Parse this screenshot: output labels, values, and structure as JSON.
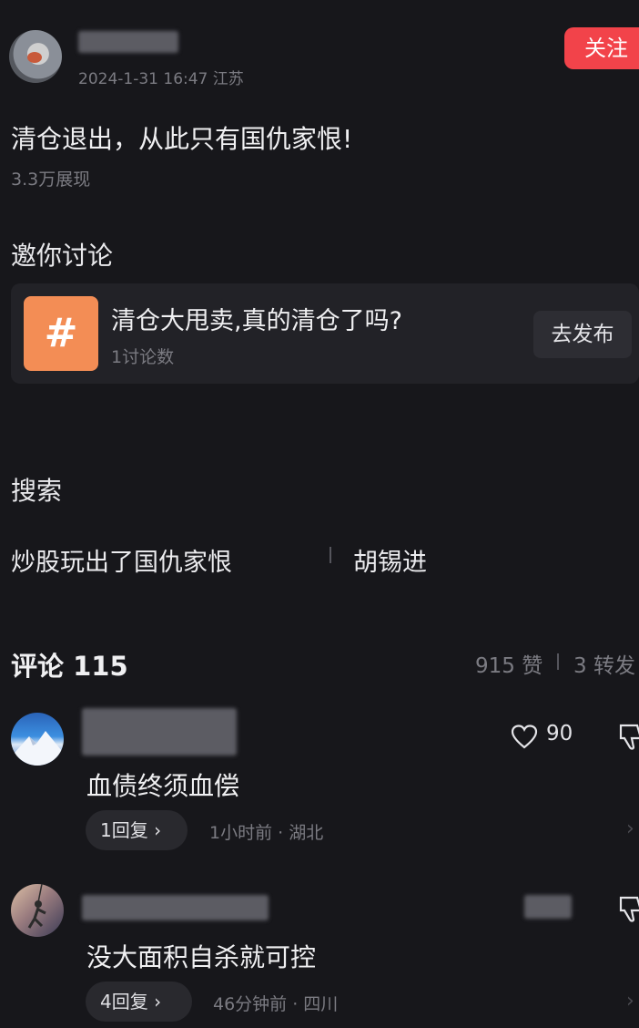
{
  "header": {
    "meta": "2024-1-31 16:47 江苏",
    "follow_label": "关注"
  },
  "post": {
    "text": "清仓退出，从此只有国仇家恨!",
    "views": "3.3万展现"
  },
  "invite": {
    "title": "邀你讨论",
    "topic_icon": "#",
    "topic_title": "清仓大甩卖,真的清仓了吗?",
    "topic_count": "1讨论数",
    "publish_label": "去发布"
  },
  "search": {
    "title": "搜索",
    "items": [
      "炒股玩出了国仇家恨",
      "胡锡进"
    ]
  },
  "comments_header": {
    "title": "评论 115",
    "likes": "915 赞",
    "shares": "3 转发"
  },
  "comments": [
    {
      "text": "血债终须血偿",
      "like_count": "90",
      "reply_label": "1回复 ›",
      "meta": "1小时前 · 湖北"
    },
    {
      "text": "没大面积自杀就可控",
      "reply_label": "4回复 ›",
      "meta": "46分钟前 · 四川"
    }
  ],
  "colors": {
    "background": "#17171b",
    "follow_button": "#f2434a",
    "topic_icon": "#f38d55"
  }
}
